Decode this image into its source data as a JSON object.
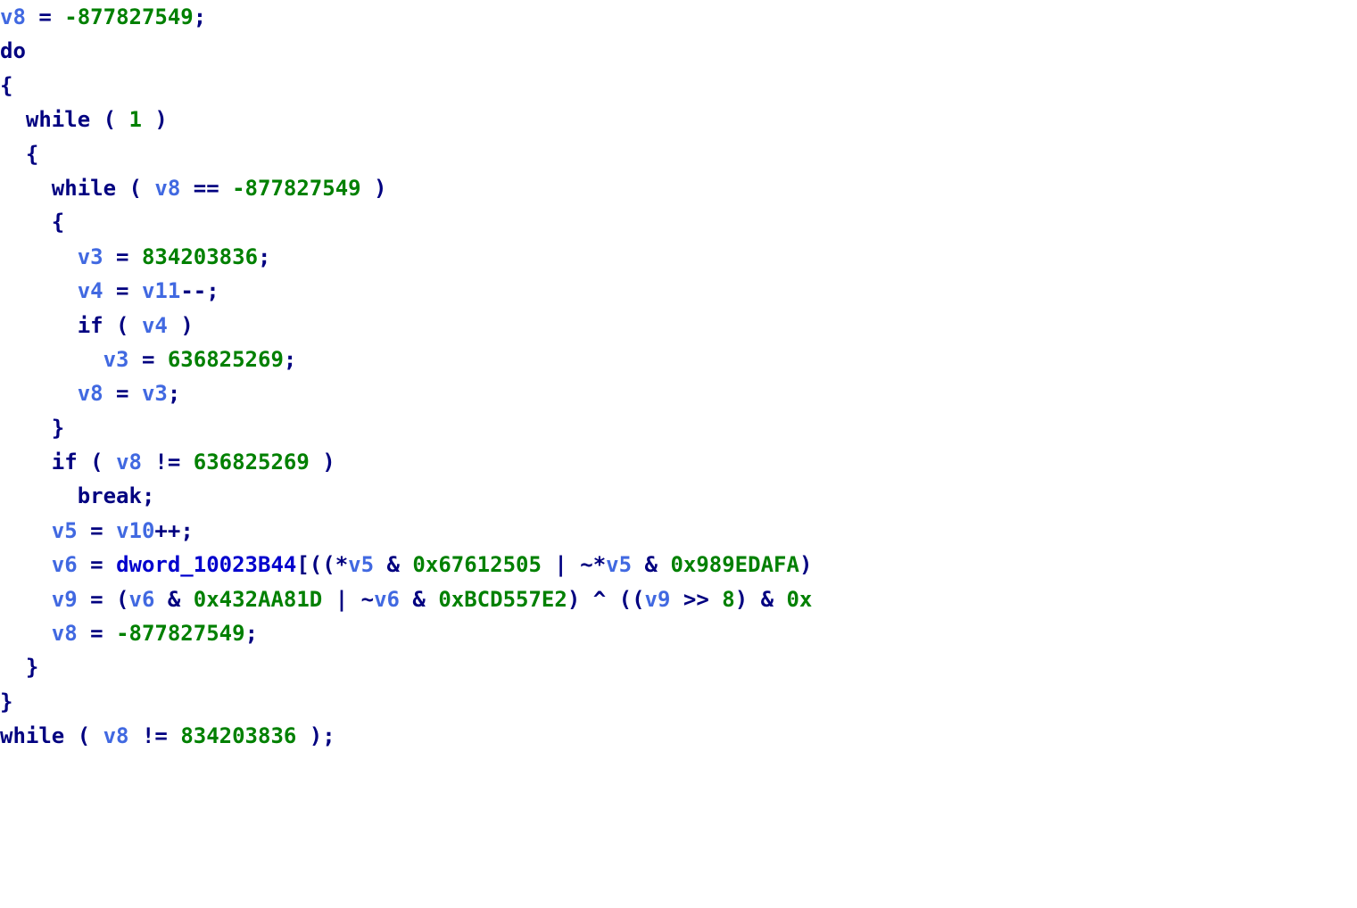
{
  "code": {
    "tokens": [
      [
        {
          "t": "v8",
          "c": "var"
        },
        {
          "t": " = ",
          "c": "op"
        },
        {
          "t": "-877827549",
          "c": "num"
        },
        {
          "t": ";",
          "c": "op"
        }
      ],
      [
        {
          "t": "do",
          "c": "kw"
        }
      ],
      [
        {
          "t": "{",
          "c": "op"
        }
      ],
      [
        {
          "t": "  ",
          "c": "op"
        },
        {
          "t": "while",
          "c": "kw"
        },
        {
          "t": " ( ",
          "c": "op"
        },
        {
          "t": "1",
          "c": "num"
        },
        {
          "t": " )",
          "c": "op"
        }
      ],
      [
        {
          "t": "  {",
          "c": "op"
        }
      ],
      [
        {
          "t": "    ",
          "c": "op"
        },
        {
          "t": "while",
          "c": "kw"
        },
        {
          "t": " ( ",
          "c": "op"
        },
        {
          "t": "v8",
          "c": "var"
        },
        {
          "t": " == ",
          "c": "op"
        },
        {
          "t": "-877827549",
          "c": "num"
        },
        {
          "t": " )",
          "c": "op"
        }
      ],
      [
        {
          "t": "    {",
          "c": "op"
        }
      ],
      [
        {
          "t": "      ",
          "c": "op"
        },
        {
          "t": "v3",
          "c": "var"
        },
        {
          "t": " = ",
          "c": "op"
        },
        {
          "t": "834203836",
          "c": "num"
        },
        {
          "t": ";",
          "c": "op"
        }
      ],
      [
        {
          "t": "      ",
          "c": "op"
        },
        {
          "t": "v4",
          "c": "var"
        },
        {
          "t": " = ",
          "c": "op"
        },
        {
          "t": "v11",
          "c": "var"
        },
        {
          "t": "--;",
          "c": "op"
        }
      ],
      [
        {
          "t": "      ",
          "c": "op"
        },
        {
          "t": "if",
          "c": "kw"
        },
        {
          "t": " ( ",
          "c": "op"
        },
        {
          "t": "v4",
          "c": "var"
        },
        {
          "t": " )",
          "c": "op"
        }
      ],
      [
        {
          "t": "        ",
          "c": "op"
        },
        {
          "t": "v3",
          "c": "var"
        },
        {
          "t": " = ",
          "c": "op"
        },
        {
          "t": "636825269",
          "c": "num"
        },
        {
          "t": ";",
          "c": "op"
        }
      ],
      [
        {
          "t": "      ",
          "c": "op"
        },
        {
          "t": "v8",
          "c": "var"
        },
        {
          "t": " = ",
          "c": "op"
        },
        {
          "t": "v3",
          "c": "var"
        },
        {
          "t": ";",
          "c": "op"
        }
      ],
      [
        {
          "t": "    }",
          "c": "op"
        }
      ],
      [
        {
          "t": "    ",
          "c": "op"
        },
        {
          "t": "if",
          "c": "kw"
        },
        {
          "t": " ( ",
          "c": "op"
        },
        {
          "t": "v8",
          "c": "var"
        },
        {
          "t": " != ",
          "c": "op"
        },
        {
          "t": "636825269",
          "c": "num"
        },
        {
          "t": " )",
          "c": "op"
        }
      ],
      [
        {
          "t": "      ",
          "c": "op"
        },
        {
          "t": "break",
          "c": "kw"
        },
        {
          "t": ";",
          "c": "op"
        }
      ],
      [
        {
          "t": "    ",
          "c": "op"
        },
        {
          "t": "v5",
          "c": "var"
        },
        {
          "t": " = ",
          "c": "op"
        },
        {
          "t": "v10",
          "c": "var"
        },
        {
          "t": "++;",
          "c": "op"
        }
      ],
      [
        {
          "t": "    ",
          "c": "op"
        },
        {
          "t": "v6",
          "c": "var"
        },
        {
          "t": " = ",
          "c": "op"
        },
        {
          "t": "dword_10023B44",
          "c": "func"
        },
        {
          "t": "[((*",
          "c": "op"
        },
        {
          "t": "v5",
          "c": "var"
        },
        {
          "t": " & ",
          "c": "op"
        },
        {
          "t": "0x67612505",
          "c": "num"
        },
        {
          "t": " | ~*",
          "c": "op"
        },
        {
          "t": "v5",
          "c": "var"
        },
        {
          "t": " & ",
          "c": "op"
        },
        {
          "t": "0x989EDAFA",
          "c": "num"
        },
        {
          "t": ")",
          "c": "op"
        }
      ],
      [
        {
          "t": "    ",
          "c": "op"
        },
        {
          "t": "v9",
          "c": "var"
        },
        {
          "t": " = (",
          "c": "op"
        },
        {
          "t": "v6",
          "c": "var"
        },
        {
          "t": " & ",
          "c": "op"
        },
        {
          "t": "0x432AA81D",
          "c": "num"
        },
        {
          "t": " | ~",
          "c": "op"
        },
        {
          "t": "v6",
          "c": "var"
        },
        {
          "t": " & ",
          "c": "op"
        },
        {
          "t": "0xBCD557E2",
          "c": "num"
        },
        {
          "t": ") ^ ((",
          "c": "op"
        },
        {
          "t": "v9",
          "c": "var"
        },
        {
          "t": " >> ",
          "c": "op"
        },
        {
          "t": "8",
          "c": "num"
        },
        {
          "t": ") & ",
          "c": "op"
        },
        {
          "t": "0x",
          "c": "num"
        }
      ],
      [
        {
          "t": "    ",
          "c": "op"
        },
        {
          "t": "v8",
          "c": "var"
        },
        {
          "t": " = ",
          "c": "op"
        },
        {
          "t": "-877827549",
          "c": "num"
        },
        {
          "t": ";",
          "c": "op"
        }
      ],
      [
        {
          "t": "  }",
          "c": "op"
        }
      ],
      [
        {
          "t": "}",
          "c": "op"
        }
      ],
      [
        {
          "t": "while",
          "c": "kw"
        },
        {
          "t": " ( ",
          "c": "op"
        },
        {
          "t": "v8",
          "c": "var"
        },
        {
          "t": " != ",
          "c": "op"
        },
        {
          "t": "834203836",
          "c": "num"
        },
        {
          "t": " );",
          "c": "op"
        }
      ]
    ]
  }
}
